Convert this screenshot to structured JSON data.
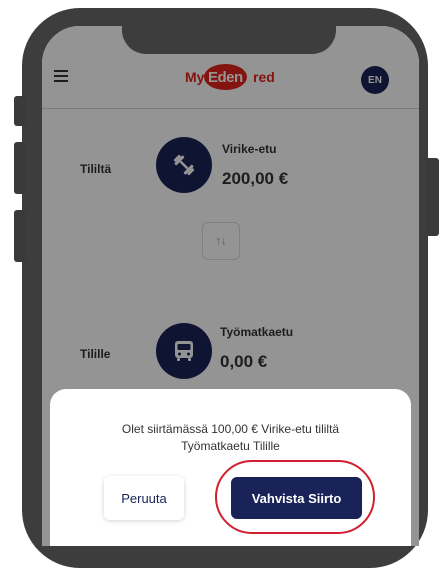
{
  "header": {
    "logo_my": "My",
    "logo_ed": "Eden",
    "logo_red": "red",
    "lang_label": "EN"
  },
  "transfer": {
    "from_label": "Tililtä",
    "from_account_name": "Virike-etu",
    "from_account_amount": "200,00 €",
    "from_icon": "dumbbell-icon",
    "to_label": "Tilille",
    "to_account_name": "Työmatkaetu",
    "to_account_amount": "0,00 €",
    "to_icon": "bus-icon",
    "swap_icon_text": "↑↓"
  },
  "dialog": {
    "message_line1": "Olet siirtämässä 100,00 € Virike-etu tililtä",
    "message_line2": "Työmatkaetu Tilille",
    "cancel_label": "Peruuta",
    "confirm_label": "Vahvista Siirto"
  },
  "colors": {
    "brand_navy": "#1a2358",
    "brand_red": "#e2231a",
    "highlight_red": "#d21f2f"
  }
}
